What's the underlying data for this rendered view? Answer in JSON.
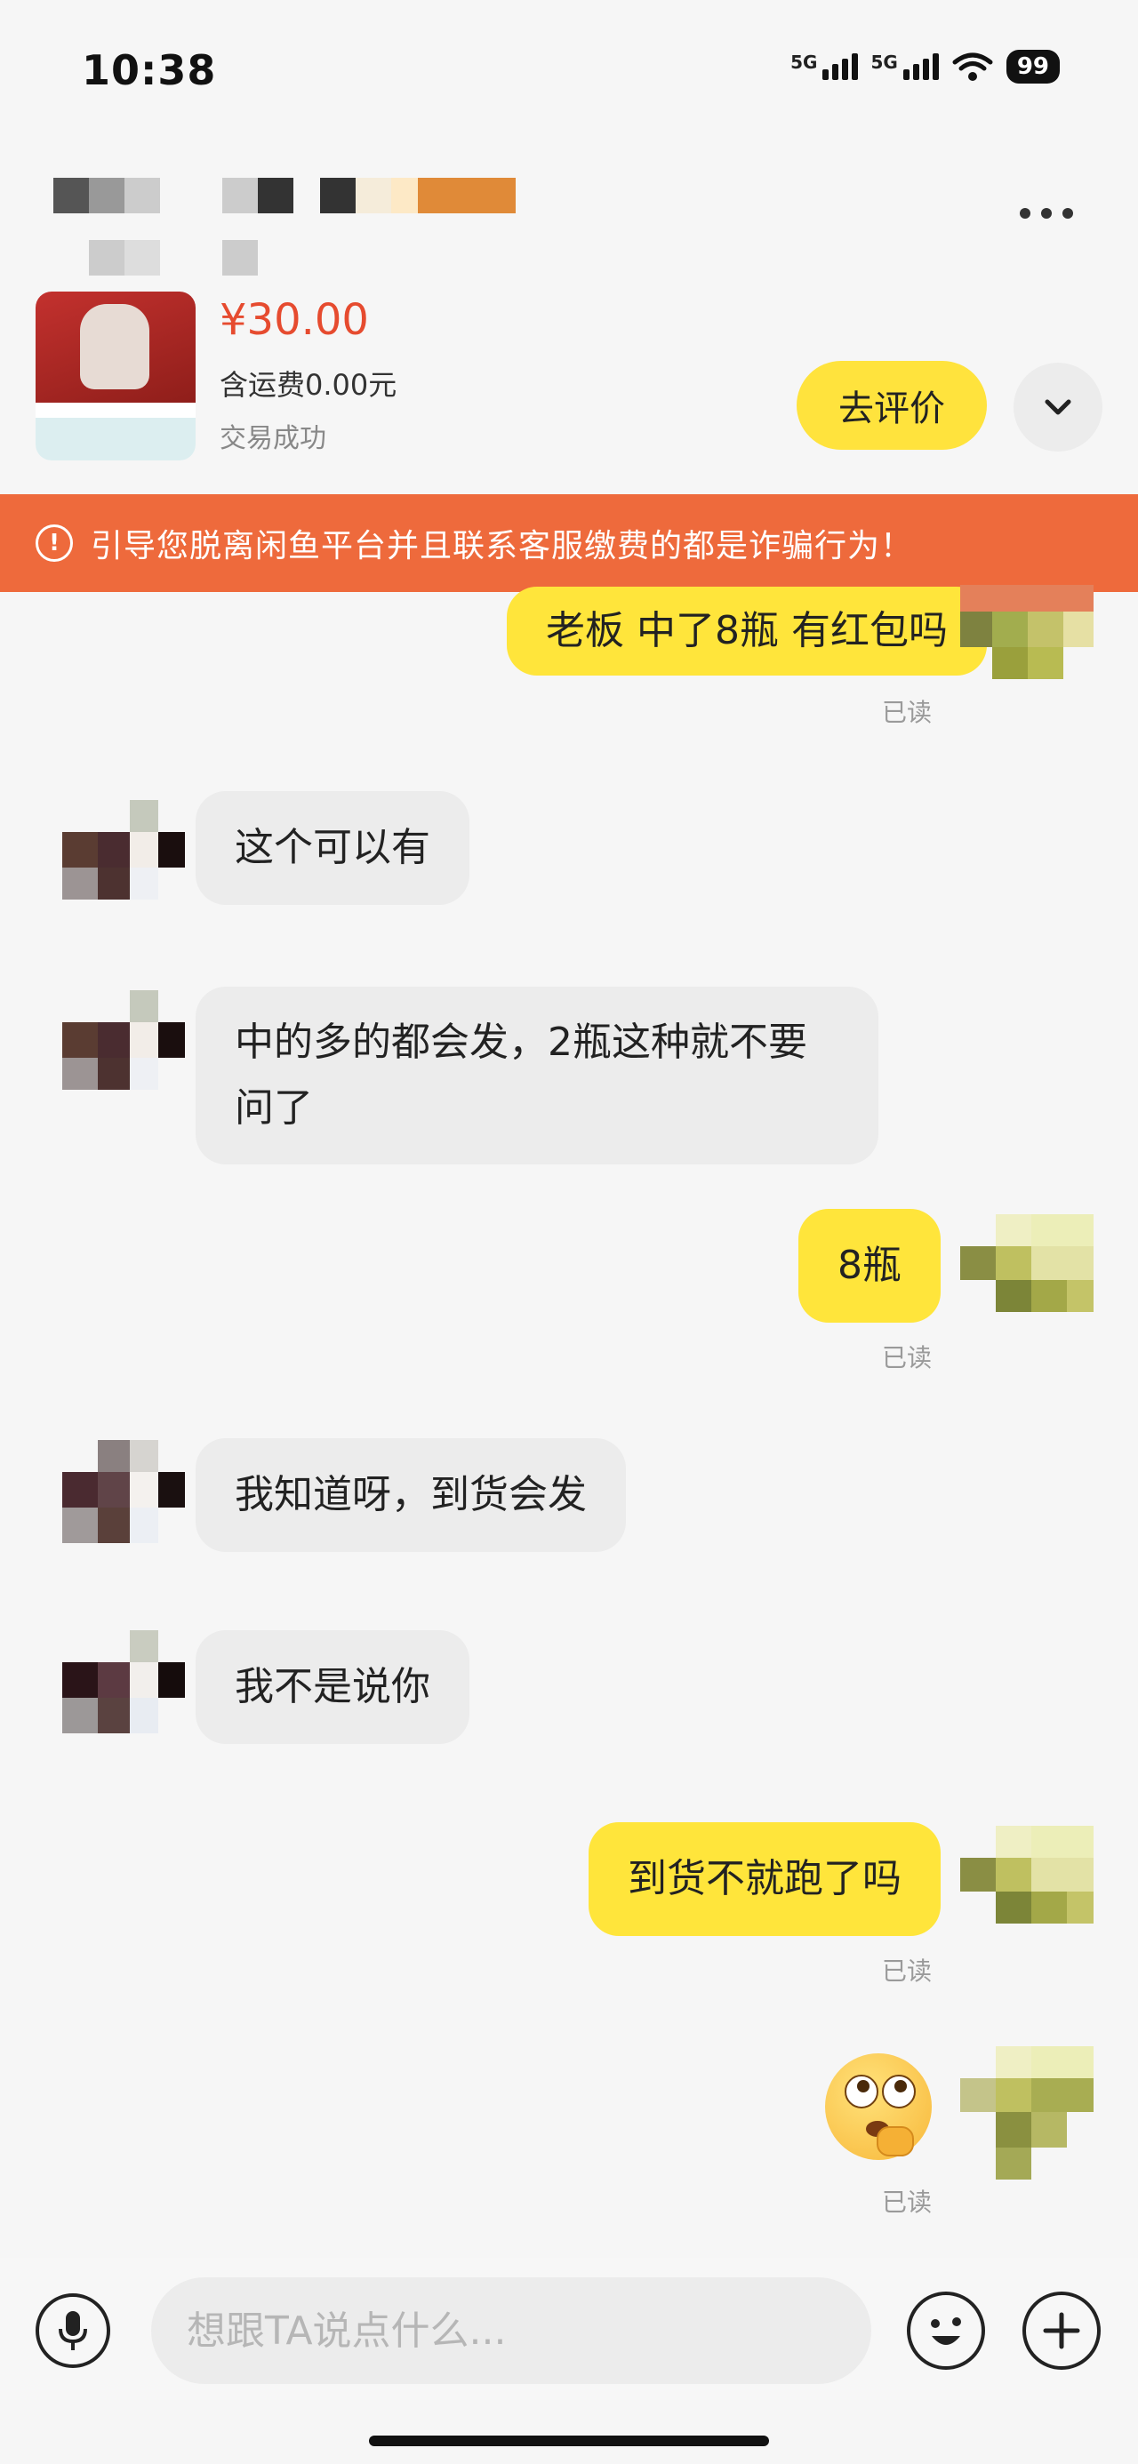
{
  "status_bar": {
    "time": "10:38",
    "network_1": "5G",
    "network_2": "5G",
    "battery": "99"
  },
  "product": {
    "price": "¥30.00",
    "shipping": "含运费0.00元",
    "status": "交易成功",
    "review_button": "去评价"
  },
  "warning": {
    "text": "引导您脱离闲鱼平台并且联系客服缴费的都是诈骗行为！"
  },
  "messages": [
    {
      "side": "out",
      "text": "老板 中了8瓶 有红包吗",
      "read": "已读"
    },
    {
      "side": "in",
      "text": "这个可以有"
    },
    {
      "side": "in",
      "text": "中的多的都会发，2瓶这种就不要问了"
    },
    {
      "side": "out",
      "text": "8瓶",
      "read": "已读"
    },
    {
      "side": "in",
      "text": "我知道呀，到货会发"
    },
    {
      "side": "in",
      "text": "我不是说你"
    },
    {
      "side": "out",
      "text": "到货不就跑了吗",
      "read": "已读"
    },
    {
      "side": "out",
      "emoji": "thinking-face",
      "read": "已读"
    }
  ],
  "input": {
    "placeholder": "想跟TA说点什么..."
  },
  "icons": {
    "more": "more-dots-icon",
    "expand": "chevron-down-icon",
    "warning": "exclamation-circle-icon",
    "mic": "microphone-icon",
    "emoji": "emoji-icon",
    "plus": "plus-icon"
  },
  "colors": {
    "accent_yellow": "#ffe53b",
    "price_red": "#e64b2f",
    "warning_orange": "#ee6a3c",
    "incoming_bubble": "#ececec"
  }
}
